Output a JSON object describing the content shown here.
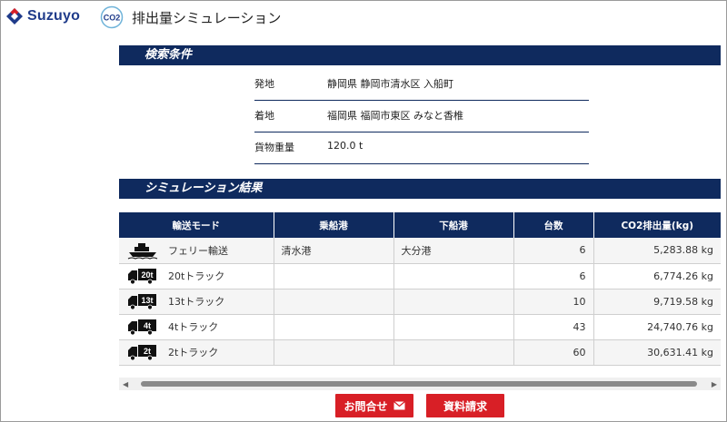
{
  "brand": {
    "logo_text": "Suzuyo",
    "co2_badge": "CO2",
    "app_title": "排出量シミュレーション"
  },
  "sections": {
    "search_title": "検索条件",
    "results_title": "シミュレーション結果"
  },
  "conditions": [
    {
      "label": "発地",
      "value": "静岡県 静岡市清水区 入船町"
    },
    {
      "label": "着地",
      "value": "福岡県 福岡市東区 みなと香椎"
    },
    {
      "label": "貨物重量",
      "value": "120.0 t"
    }
  ],
  "table": {
    "headers": [
      "輸送モード",
      "乗船港",
      "下船港",
      "台数",
      "CO2排出量(kg)"
    ],
    "rows": [
      {
        "icon": "ferry-icon",
        "icon_label": "",
        "mode": "フェリー輸送",
        "board_port": "清水港",
        "alight_port": "大分港",
        "count": "6",
        "co2": "5,283.88 kg"
      },
      {
        "icon": "truck-icon",
        "icon_label": "20t",
        "mode": "20tトラック",
        "board_port": "",
        "alight_port": "",
        "count": "6",
        "co2": "6,774.26 kg"
      },
      {
        "icon": "truck-icon",
        "icon_label": "13t",
        "mode": "13tトラック",
        "board_port": "",
        "alight_port": "",
        "count": "10",
        "co2": "9,719.58 kg"
      },
      {
        "icon": "truck-icon",
        "icon_label": "4t",
        "mode": "4tトラック",
        "board_port": "",
        "alight_port": "",
        "count": "43",
        "co2": "24,740.76 kg"
      },
      {
        "icon": "truck-icon",
        "icon_label": "2t",
        "mode": "2tトラック",
        "board_port": "",
        "alight_port": "",
        "count": "60",
        "co2": "30,631.41 kg"
      }
    ]
  },
  "buttons": {
    "contact": "お問合せ",
    "documents": "資料請求"
  },
  "colors": {
    "navy": "#0f2a5e",
    "red": "#d81f26",
    "brand_blue": "#1f3b8a"
  }
}
